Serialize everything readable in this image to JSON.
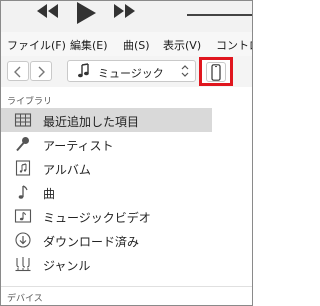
{
  "transport": {
    "rewind_icon": "rewind-icon",
    "play_icon": "play-icon",
    "fast_forward_icon": "fast-forward-icon"
  },
  "menu": {
    "items": [
      "ファイル(F)",
      "編集(E)",
      "曲(S)",
      "表示(V)",
      "コントロ"
    ]
  },
  "toolbar": {
    "back_icon": "chevron-left-icon",
    "forward_icon": "chevron-right-icon",
    "source_label": "ミュージック",
    "source_icon": "music-note-icon",
    "device_icon": "iphone-icon",
    "highlight_color": "#e0161e"
  },
  "sidebar": {
    "library_header": "ライブラリ",
    "items": [
      {
        "label": "最近追加した項目",
        "icon": "grid-icon",
        "selected": true
      },
      {
        "label": "アーティスト",
        "icon": "microphone-icon",
        "selected": false
      },
      {
        "label": "アルバム",
        "icon": "album-icon",
        "selected": false
      },
      {
        "label": "曲",
        "icon": "music-note-icon",
        "selected": false
      },
      {
        "label": "ミュージックビデオ",
        "icon": "music-video-icon",
        "selected": false
      },
      {
        "label": "ダウンロード済み",
        "icon": "download-icon",
        "selected": false
      },
      {
        "label": "ジャンル",
        "icon": "genre-icon",
        "selected": false
      }
    ],
    "devices_header": "デバイス"
  }
}
